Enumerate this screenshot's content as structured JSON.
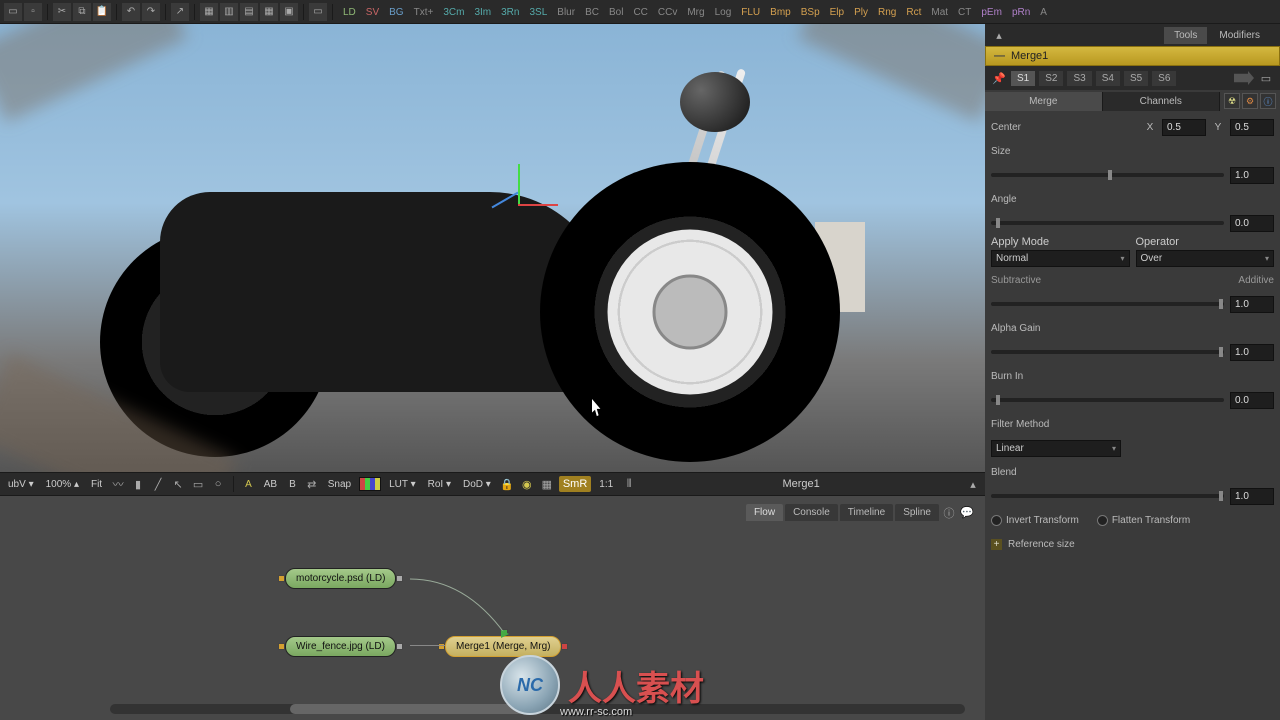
{
  "toolbar": {
    "buttons": [
      "LD",
      "SV",
      "BG",
      "Txt+",
      "3Cm",
      "3Im",
      "3Rn",
      "3SL",
      "Blur",
      "BC",
      "Bol",
      "CC",
      "CCv",
      "Mrg",
      "Log",
      "FLU",
      "Bmp",
      "BSp",
      "Elp",
      "Ply",
      "Rng",
      "Rct",
      "Mat",
      "CT",
      "pEm",
      "pRn",
      "A"
    ],
    "button_colors": [
      "col-green",
      "col-red",
      "col-blue",
      "col-gray",
      "col-teal",
      "col-teal",
      "col-teal",
      "col-teal",
      "col-gray",
      "col-gray",
      "col-gray",
      "col-gray",
      "col-gray",
      "col-gray",
      "col-gray",
      "col-orange",
      "col-orange",
      "col-orange",
      "col-orange",
      "col-orange",
      "col-orange",
      "col-orange",
      "col-gray",
      "col-gray",
      "col-purple",
      "col-purple",
      "col-gray"
    ]
  },
  "viewer_bar": {
    "subv": "ubV ▾",
    "zoom": "100% ▴",
    "fit": "Fit",
    "a": "A",
    "ab": "AB",
    "b": "B",
    "snap": "Snap",
    "lut": "LUT ▾",
    "roi": "RoI ▾",
    "dod": "DoD ▾",
    "smr": "SmR",
    "ratio": "1:1",
    "current_node": "Merge1"
  },
  "flow": {
    "tabs": [
      "Flow",
      "Console",
      "Timeline",
      "Spline"
    ],
    "active_tab": 0,
    "node1": "motorcycle.psd  (LD)",
    "node2": "Wire_fence.jpg  (LD)",
    "node3": "Merge1  (Merge, Mrg)"
  },
  "right_panel": {
    "tabs": [
      "Tools",
      "Modifiers"
    ],
    "active_tab": 0,
    "node_name": "Merge1",
    "sel": [
      "S1",
      "S2",
      "S3",
      "S4",
      "S5",
      "S6"
    ],
    "sub_tabs": [
      "Merge",
      "Channels"
    ]
  },
  "props": {
    "center_label": "Center",
    "center_x_axis": "X",
    "center_x": "0.5",
    "center_y_axis": "Y",
    "center_y": "0.5",
    "size_label": "Size",
    "size_val": "1.0",
    "angle_label": "Angle",
    "angle_val": "0.0",
    "apply_label": "Apply Mode",
    "apply_val": "Normal",
    "operator_label": "Operator",
    "operator_val": "Over",
    "subtractive_label": "Subtractive",
    "additive_label": "Additive",
    "blend_val": "1.0",
    "alpha_label": "Alpha Gain",
    "alpha_val": "1.0",
    "burn_label": "Burn In",
    "burn_val": "0.0",
    "filter_label": "Filter Method",
    "filter_val": "Linear",
    "blend_label": "Blend",
    "blend2_val": "1.0",
    "invert_label": "Invert Transform",
    "flatten_label": "Flatten Transform",
    "refsize_label": "Reference size"
  },
  "watermark": {
    "badge": "NC",
    "text": "人人素材",
    "url": "www.rr-sc.com"
  }
}
